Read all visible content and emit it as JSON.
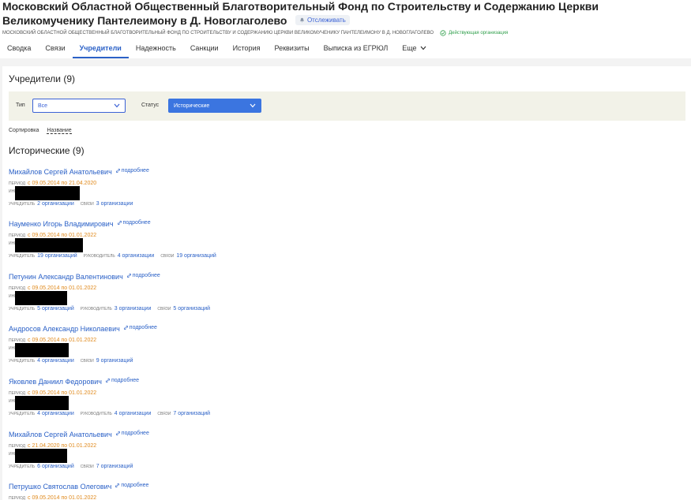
{
  "header": {
    "title": "Московский Областной Общественный Благотворительный Фонд по Строительству и Содержанию Церкви Великомученику Пантелеимону в Д. Новоглаголево",
    "follow_label": "Отслеживать",
    "subtitle": "МОСКОВСКИЙ ОБЛАСТНОЙ ОБЩЕСТВЕННЫЙ БЛАГОТВОРИТЕЛЬНЫЙ ФОНД ПО СТРОИТЕЛЬСТВУ И СОДЕРЖАНИЮ ЦЕРКВИ ВЕЛИКОМУЧЕНИКУ ПАНТЕЛЕИМОНУ В Д. НОВОГЛАГОЛЕВО",
    "status": "Действующая организация"
  },
  "tabs": [
    "Сводка",
    "Связи",
    "Учредители",
    "Надежность",
    "Санкции",
    "История",
    "Реквизиты",
    "Выписка из ЕГРЮЛ",
    "Еще"
  ],
  "active_tab": "Учредители",
  "panel": {
    "title": "Учредители (9)",
    "filters": {
      "type_label": "Тип",
      "type_value": "Все",
      "status_label": "Статус",
      "status_value": "Исторические"
    },
    "sort_label": "Сортировка",
    "sort_value": "Название",
    "section_title": "Исторические (9)"
  },
  "labels": {
    "more": "подробнее",
    "period": "период",
    "inn": "инн",
    "founder": "учредитель",
    "head": "руководитель",
    "links": "связи"
  },
  "founders": [
    {
      "name": "Михайлов Сергей Анатольевич",
      "period": "с 09.05.2014 по 21.04.2020",
      "founder": "2 организации",
      "head": null,
      "links": "3 организации"
    },
    {
      "name": "Науменко Игорь Владимирович",
      "period": "с 09.05.2014 по 01.01.2022",
      "founder": "19 организаций",
      "head": "4 организации",
      "links": "19 организаций"
    },
    {
      "name": "Петунин Александр Валентинович",
      "period": "с 09.05.2014 по 01.01.2022",
      "founder": "5 организаций",
      "head": "3 организации",
      "links": "5 организаций"
    },
    {
      "name": "Андросов Александр Николаевич",
      "period": "с 09.05.2014 по 01.01.2022",
      "founder": "4 организации",
      "head": null,
      "links": "9 организаций"
    },
    {
      "name": "Яковлев Даниил Федорович",
      "period": "с 09.05.2014 по 01.01.2022",
      "founder": "4 организации",
      "head": "4 организации",
      "links": "7 организаций"
    },
    {
      "name": "Михайлов Сергей Анатольевич",
      "period": "с 21.04.2020 по 01.01.2022",
      "founder": "6 организаций",
      "head": null,
      "links": "7 организаций"
    },
    {
      "name": "Петрушко Святослав Олегович",
      "period": "с 09.05.2014 по 01.01.2022",
      "founder": null,
      "head": null,
      "links": null
    }
  ],
  "colors": {
    "accent": "#2b61c7",
    "period": "#e0891b",
    "status_green": "#2e9e4a",
    "filter_bg": "#f2f2e8"
  }
}
